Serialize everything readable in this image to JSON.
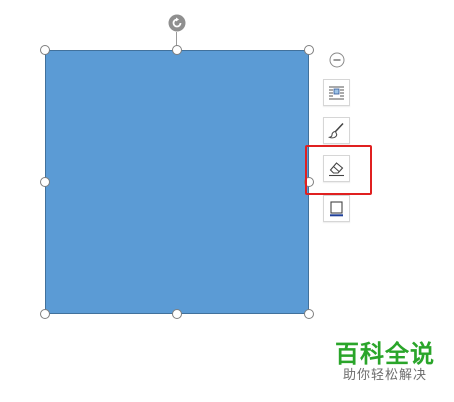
{
  "canvas": {
    "shape": {
      "kind": "rectangle",
      "fill": "#5b9bd5",
      "outline": "#41719c",
      "selected": true
    }
  },
  "layout_options": {
    "collapse_icon": "minus-circle-icon",
    "tools": [
      {
        "name": "wrap-text",
        "icon": "wrap-text-icon"
      },
      {
        "name": "shape-fill",
        "icon": "paint-brush-icon"
      },
      {
        "name": "shape-outline",
        "icon": "eraser-icon",
        "highlighted": true
      },
      {
        "name": "border",
        "icon": "border-icon"
      }
    ]
  },
  "annotation": {
    "highlight_color": "#e02020"
  },
  "watermark": {
    "title": "百科全说",
    "subtitle": "助你轻松解决",
    "title_color": "#2aa52a"
  }
}
